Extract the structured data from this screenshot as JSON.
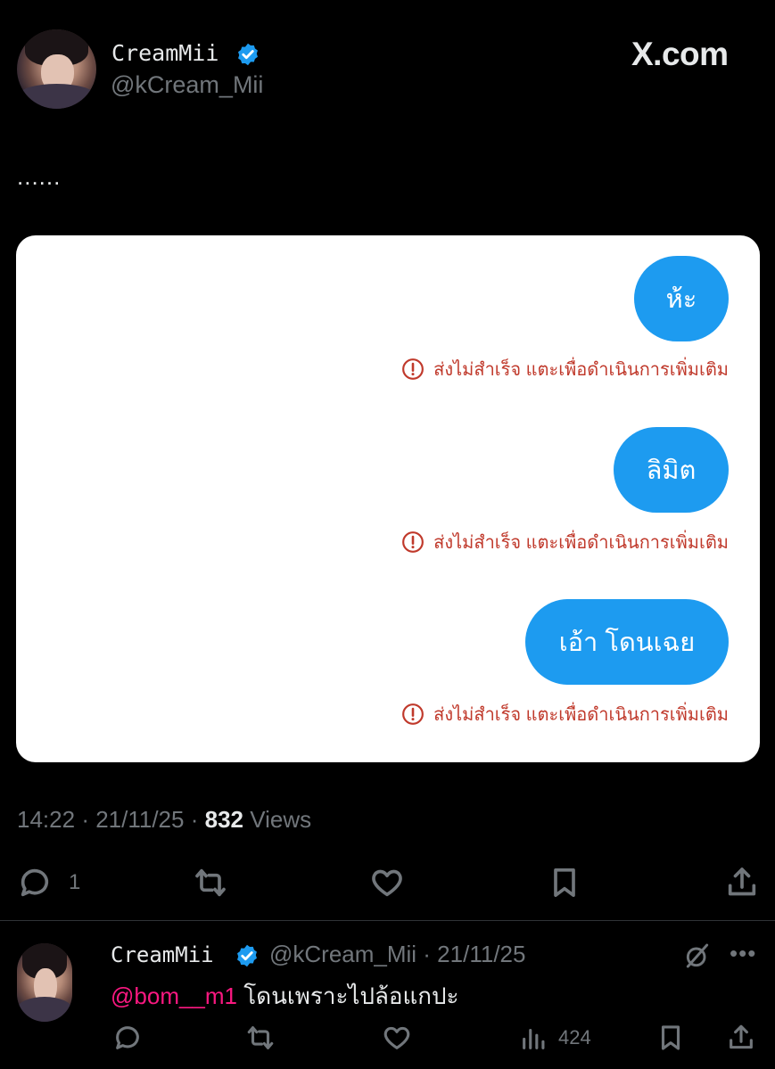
{
  "tweet": {
    "author": {
      "display_name": "CreamMii",
      "handle": "@kCream_Mii",
      "verified": true,
      "verified_color": "#1d9bf0"
    },
    "source_watermark": "X.com",
    "text": "......",
    "image": {
      "messages": [
        {
          "text": "ห้ะ",
          "error": "ส่งไม่สำเร็จ แตะเพื่อดำเนินการเพิ่มเติม"
        },
        {
          "text": "ลิมิต",
          "error": "ส่งไม่สำเร็จ แตะเพื่อดำเนินการเพิ่มเติม"
        },
        {
          "text": "เอ้า โดนเฉย",
          "error": "ส่งไม่สำเร็จ แตะเพื่อดำเนินการเพิ่มเติม"
        }
      ],
      "bubble_color": "#1d9bf0",
      "error_color": "#c0392b"
    },
    "meta": {
      "time": "14:22",
      "date": "21/11/25",
      "views_count": "832",
      "views_label": "Views"
    },
    "actions": {
      "reply_count": "1",
      "icons": [
        "reply-icon",
        "retweet-icon",
        "like-icon",
        "bookmark-icon",
        "share-icon"
      ]
    }
  },
  "reply": {
    "author": {
      "display_name": "CreamMii",
      "handle_date": "@kCream_Mii · 21/11/25",
      "verified": true
    },
    "mention": "@bom__m1",
    "text": " โดนเพราะไปล้อแกปะ",
    "views_count": "424",
    "icons": [
      "grok-icon",
      "more-icon",
      "reply-icon",
      "retweet-icon",
      "like-icon",
      "views-icon",
      "bookmark-icon",
      "share-icon"
    ]
  },
  "colors": {
    "background": "#000000",
    "text_primary": "#e7e9ea",
    "text_secondary": "#71767b",
    "mention": "#f91880"
  }
}
